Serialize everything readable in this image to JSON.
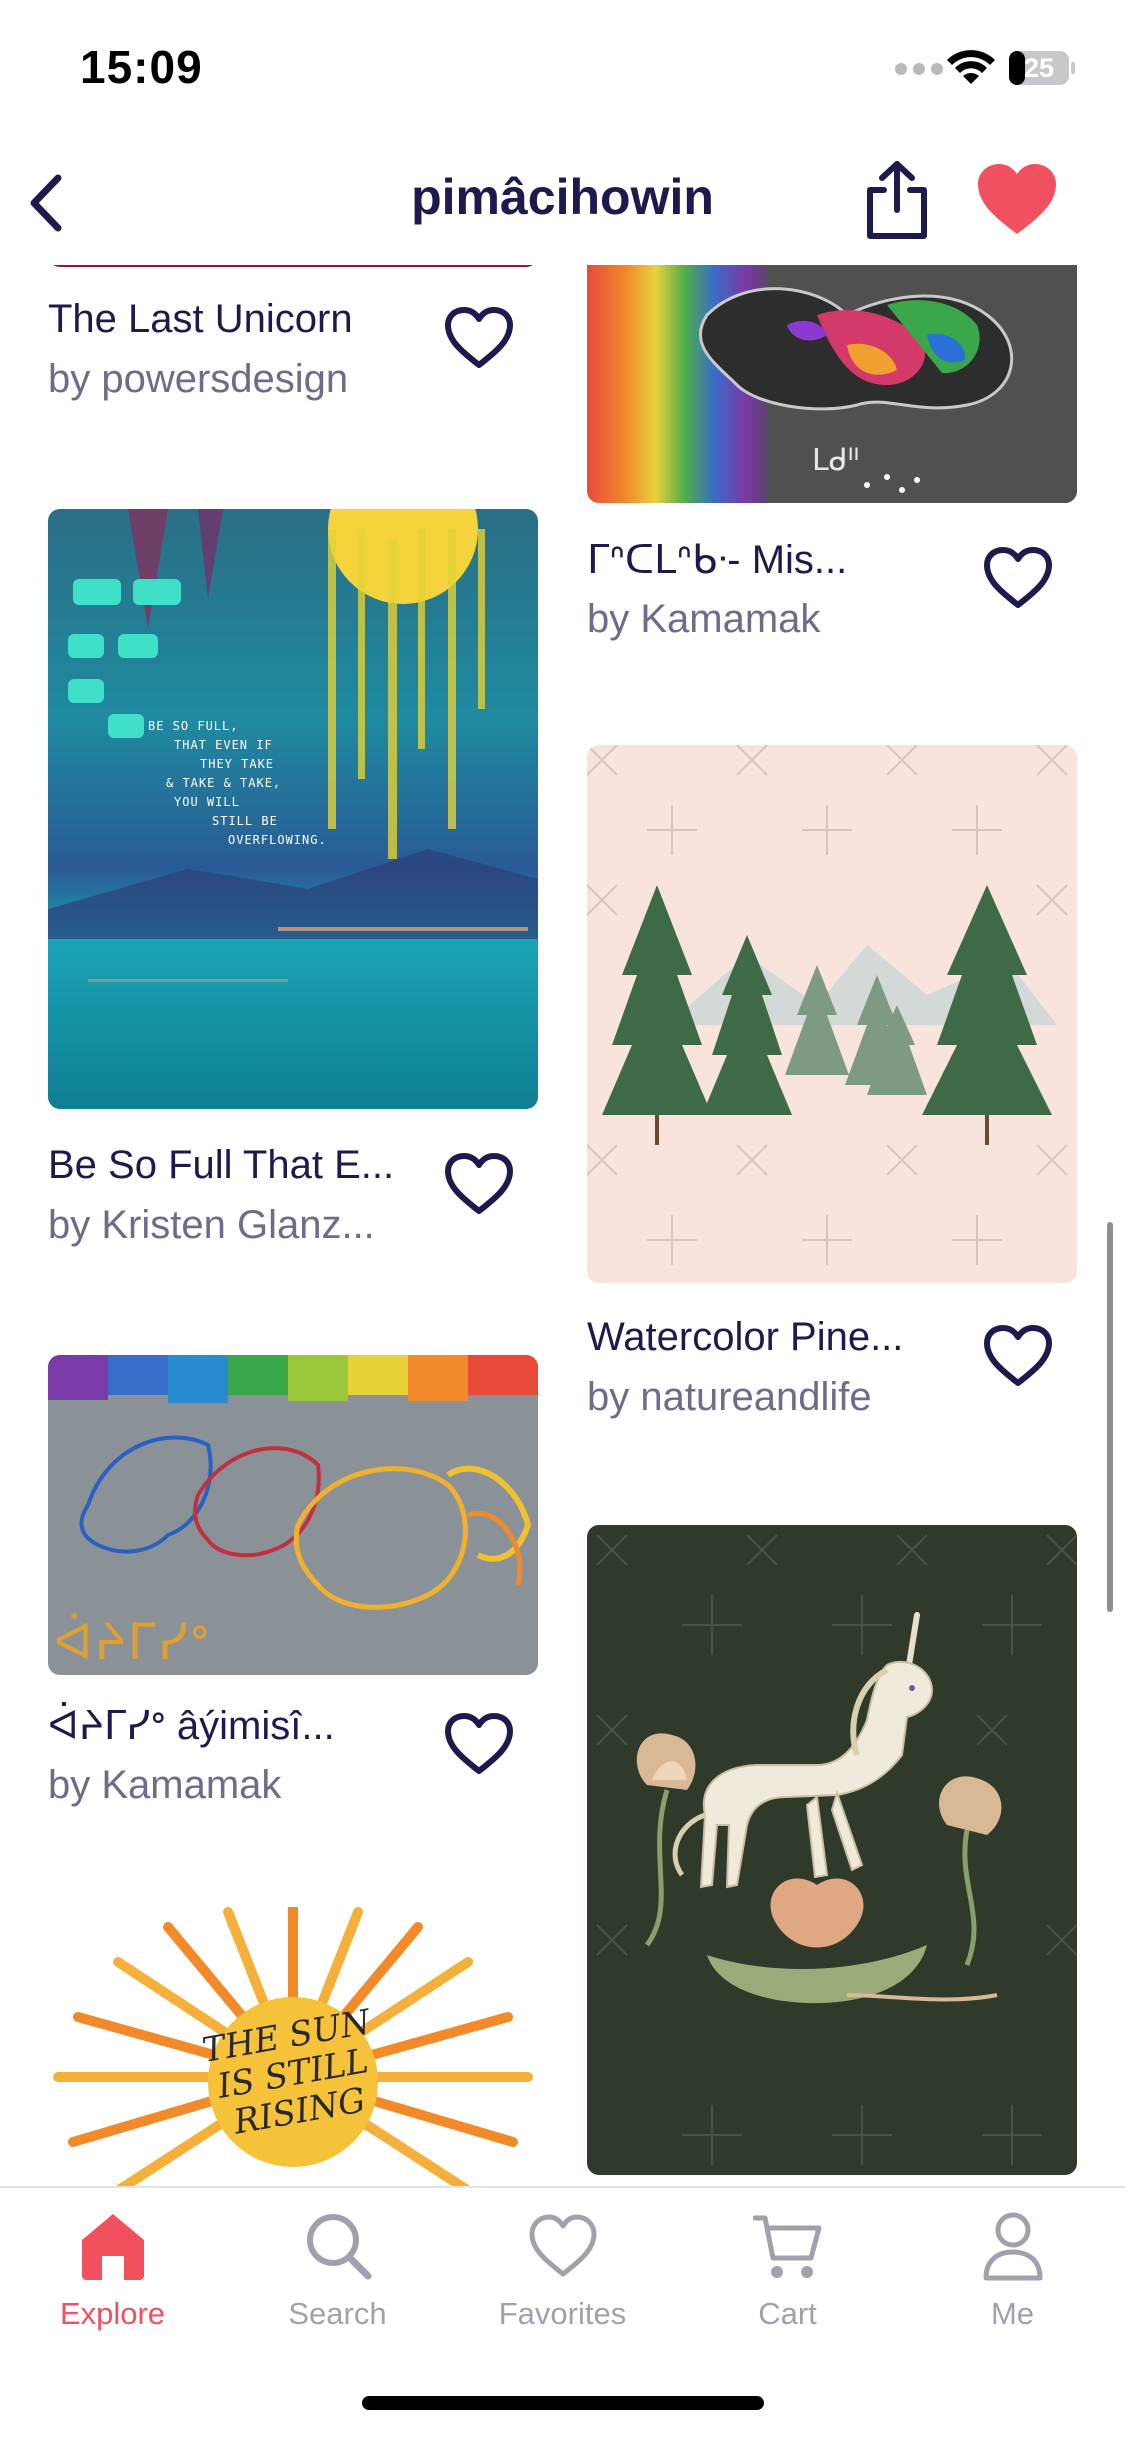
{
  "status": {
    "time": "15:09",
    "battery": "25"
  },
  "header": {
    "title": "pimâcihowin"
  },
  "cards": [
    {
      "title": "The Last Unicorn",
      "artist": "by powersdesign"
    },
    {
      "title": "ᒥᐢᑕᒪᐢᑲᐧ- Mis...",
      "artist": "by Kamamak"
    },
    {
      "title": "Be So Full That E...",
      "artist": "by Kristen Glanz...",
      "poem": [
        "BE SO FULL,",
        "THAT EVEN IF",
        "THEY TAKE",
        "& TAKE & TAKE,",
        "YOU WILL",
        "STILL BE",
        "OVERFLOWING."
      ]
    },
    {
      "title": "Watercolor Pine...",
      "artist": "by natureandlife"
    },
    {
      "title": "ᐋᔨᒥᓯᐤ âýimisî...",
      "artist": "by Kamamak",
      "caption": "ᐋᔨᒥᓯᐤ"
    },
    {
      "sun_text": [
        "THE SUN",
        "IS STILL",
        "RISING"
      ]
    }
  ],
  "tabs": [
    {
      "label": "Explore",
      "icon": "home-icon",
      "active": true
    },
    {
      "label": "Search",
      "icon": "search-icon",
      "active": false
    },
    {
      "label": "Favorites",
      "icon": "heart-outline-icon",
      "active": false
    },
    {
      "label": "Cart",
      "icon": "cart-icon",
      "active": false
    },
    {
      "label": "Me",
      "icon": "profile-icon",
      "active": false
    }
  ],
  "colors": {
    "accent": "#f1515f",
    "title": "#1d1b4e",
    "muted": "#6e6c8a",
    "tab_inactive": "#a1a1ad"
  }
}
